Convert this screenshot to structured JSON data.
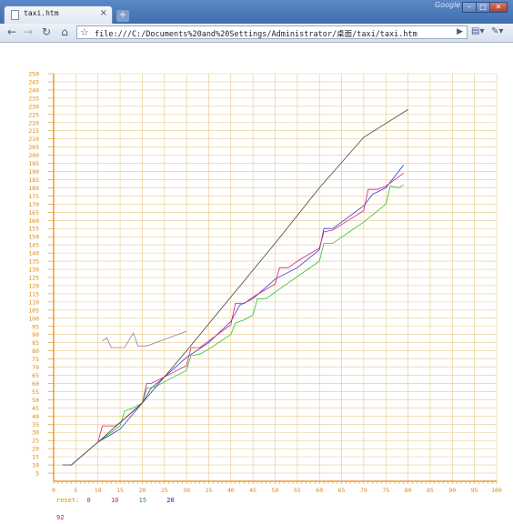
{
  "browser": {
    "tab_title": "taxi.htm",
    "tab_close": "×",
    "new_tab": "+",
    "brand": "Google",
    "url": "file:///C:/Documents%20and%20Settings/Administrator/桌面/taxi/taxi.htm",
    "win_min": "–",
    "win_max": "□",
    "win_close": "✕"
  },
  "colors": {
    "grid": "#e8c98a",
    "axis": "#e08a10",
    "series": [
      "#3a3ad0",
      "#d02080",
      "#30c030",
      "#9080b0",
      "#444444"
    ]
  },
  "chart_data": {
    "type": "line",
    "xlim": [
      0,
      100
    ],
    "ylim": [
      0,
      250
    ],
    "x_ticks": [
      0,
      5,
      10,
      15,
      20,
      25,
      30,
      35,
      40,
      45,
      50,
      55,
      60,
      65,
      70,
      75,
      80,
      85,
      90,
      95,
      100
    ],
    "y_ticks": [
      5,
      10,
      15,
      20,
      25,
      30,
      35,
      40,
      45,
      50,
      55,
      60,
      65,
      70,
      75,
      80,
      85,
      90,
      95,
      100,
      105,
      110,
      115,
      120,
      125,
      130,
      135,
      140,
      145,
      150,
      155,
      160,
      165,
      170,
      175,
      180,
      185,
      190,
      195,
      200,
      205,
      210,
      215,
      220,
      225,
      230,
      235,
      240,
      245,
      250
    ],
    "grid": true,
    "series": [
      {
        "points": [
          [
            2,
            10
          ],
          [
            4,
            10
          ],
          [
            10,
            24
          ],
          [
            15,
            32
          ],
          [
            20,
            48
          ],
          [
            22,
            57
          ],
          [
            25,
            64
          ],
          [
            30,
            76
          ],
          [
            35,
            85
          ],
          [
            40,
            98
          ],
          [
            42,
            108
          ],
          [
            45,
            112
          ],
          [
            50,
            124
          ],
          [
            55,
            131
          ],
          [
            60,
            142
          ],
          [
            61,
            155
          ],
          [
            63,
            155
          ],
          [
            70,
            169
          ],
          [
            72,
            176
          ],
          [
            75,
            180
          ],
          [
            79,
            194
          ]
        ]
      },
      {
        "points": [
          [
            10,
            24
          ],
          [
            11,
            34
          ],
          [
            14,
            34
          ],
          [
            15,
            36
          ],
          [
            18,
            43
          ],
          [
            20,
            48
          ],
          [
            21,
            60
          ],
          [
            22,
            60
          ],
          [
            25,
            64
          ],
          [
            30,
            71
          ],
          [
            31,
            82
          ],
          [
            33,
            82
          ],
          [
            35,
            86
          ],
          [
            40,
            96
          ],
          [
            41,
            109
          ],
          [
            43,
            109
          ],
          [
            45,
            113
          ],
          [
            50,
            121
          ],
          [
            51,
            131
          ],
          [
            53,
            131
          ],
          [
            55,
            135
          ],
          [
            60,
            143
          ],
          [
            61,
            153
          ],
          [
            63,
            154
          ],
          [
            70,
            166
          ],
          [
            71,
            179
          ],
          [
            73,
            179
          ],
          [
            75,
            181
          ],
          [
            79,
            189
          ]
        ]
      },
      {
        "points": [
          [
            10,
            24
          ],
          [
            15,
            34
          ],
          [
            16,
            43
          ],
          [
            18,
            45
          ],
          [
            20,
            48
          ],
          [
            21,
            57
          ],
          [
            23,
            58
          ],
          [
            25,
            61
          ],
          [
            30,
            68
          ],
          [
            31,
            77
          ],
          [
            33,
            78
          ],
          [
            35,
            81
          ],
          [
            40,
            90
          ],
          [
            41,
            97
          ],
          [
            43,
            99
          ],
          [
            45,
            102
          ],
          [
            46,
            112
          ],
          [
            48,
            112
          ],
          [
            50,
            116
          ],
          [
            60,
            135
          ],
          [
            61,
            146
          ],
          [
            63,
            146
          ],
          [
            70,
            159
          ],
          [
            75,
            170
          ],
          [
            76,
            181
          ],
          [
            78,
            180
          ],
          [
            79,
            182
          ]
        ]
      },
      {
        "points": [
          [
            11,
            86
          ],
          [
            12,
            88
          ],
          [
            13,
            82
          ],
          [
            16,
            82
          ],
          [
            18,
            91
          ],
          [
            19,
            83
          ],
          [
            21,
            83
          ],
          [
            23,
            85
          ],
          [
            25,
            87
          ],
          [
            30,
            92
          ]
        ]
      },
      {
        "points": [
          [
            2,
            10
          ],
          [
            4,
            10
          ],
          [
            10,
            24
          ],
          [
            20,
            48
          ],
          [
            30,
            80
          ],
          [
            40,
            113
          ],
          [
            50,
            146
          ],
          [
            60,
            180
          ],
          [
            70,
            211
          ],
          [
            80,
            228
          ]
        ]
      }
    ]
  },
  "legend": {
    "label": "reset:",
    "items": [
      {
        "text": "0",
        "color": "#d02020"
      },
      {
        "text": "10",
        "color": "#d02060"
      },
      {
        "text": "15",
        "color": "#20a020"
      },
      {
        "text": "20",
        "color": "#2020c0"
      }
    ],
    "footer": "92"
  }
}
